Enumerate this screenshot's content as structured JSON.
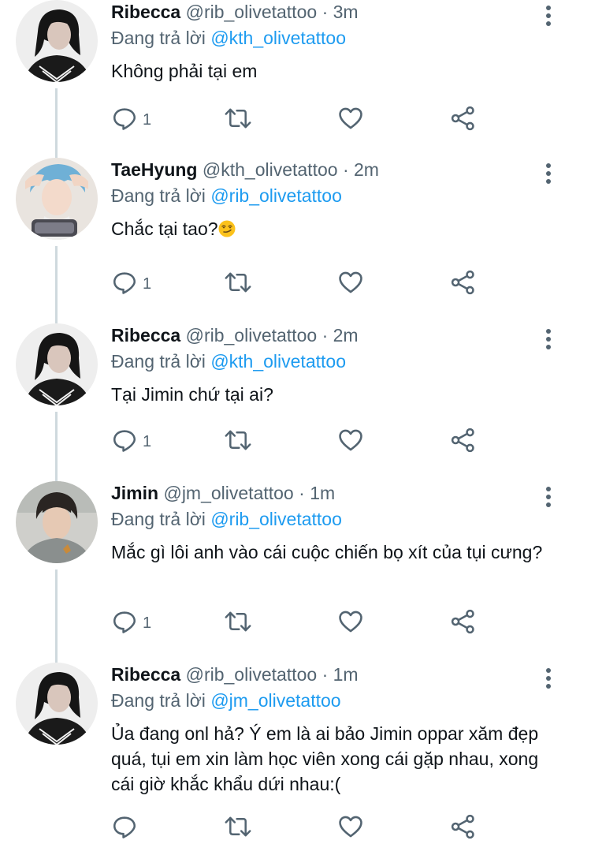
{
  "tweets": [
    {
      "name": "Ribecca",
      "handle": "@rib_olivetattoo",
      "sep": "·",
      "time": "3m",
      "reply_prefix": "Đang trả lời ",
      "reply_to": "@kth_olivetattoo",
      "text": "Không phải tại em",
      "reply_count": "1",
      "avatar_icon": "girl-avatar"
    },
    {
      "name": "TaeHyung",
      "handle": "@kth_olivetattoo",
      "sep": "·",
      "time": "2m",
      "reply_prefix": "Đang trả lời ",
      "reply_to": "@rib_olivetattoo",
      "text": "Chắc tại tao?",
      "text_emoji": "smirking-face-emoji",
      "reply_count": "1",
      "avatar_icon": "blue-hair-avatar"
    },
    {
      "name": "Ribecca",
      "handle": "@rib_olivetattoo",
      "sep": "·",
      "time": "2m",
      "reply_prefix": "Đang trả lời ",
      "reply_to": "@kth_olivetattoo",
      "text": "Tại Jimin chứ tại ai?",
      "reply_count": "1",
      "avatar_icon": "girl-avatar"
    },
    {
      "name": "Jimin",
      "handle": "@jm_olivetattoo",
      "sep": "·",
      "time": "1m",
      "reply_prefix": "Đang trả lời ",
      "reply_to": "@rib_olivetattoo",
      "text": "Mắc gì lôi anh vào cái cuộc chiến bọ xít của tụi cưng?",
      "reply_count": "1",
      "avatar_icon": "man-avatar"
    },
    {
      "name": "Ribecca",
      "handle": "@rib_olivetattoo",
      "sep": "·",
      "time": "1m",
      "reply_prefix": "Đang trả lời ",
      "reply_to": "@jm_olivetattoo",
      "text": "Ủa đang onl hả? Ý em là ai bảo Jimin oppar xăm đẹp quá, tụi em xin làm học viên xong cái gặp nhau, xong cái giờ khắc khẩu dứi nhau:(",
      "reply_count": "",
      "avatar_icon": "girl-avatar"
    }
  ],
  "colors": {
    "link": "#1d9bf0",
    "secondary_text": "#536471",
    "thread_line": "#cfd9de",
    "icon": "#536471"
  },
  "icons": [
    "reply-icon",
    "retweet-icon",
    "like-icon",
    "share-icon",
    "more-icon"
  ]
}
